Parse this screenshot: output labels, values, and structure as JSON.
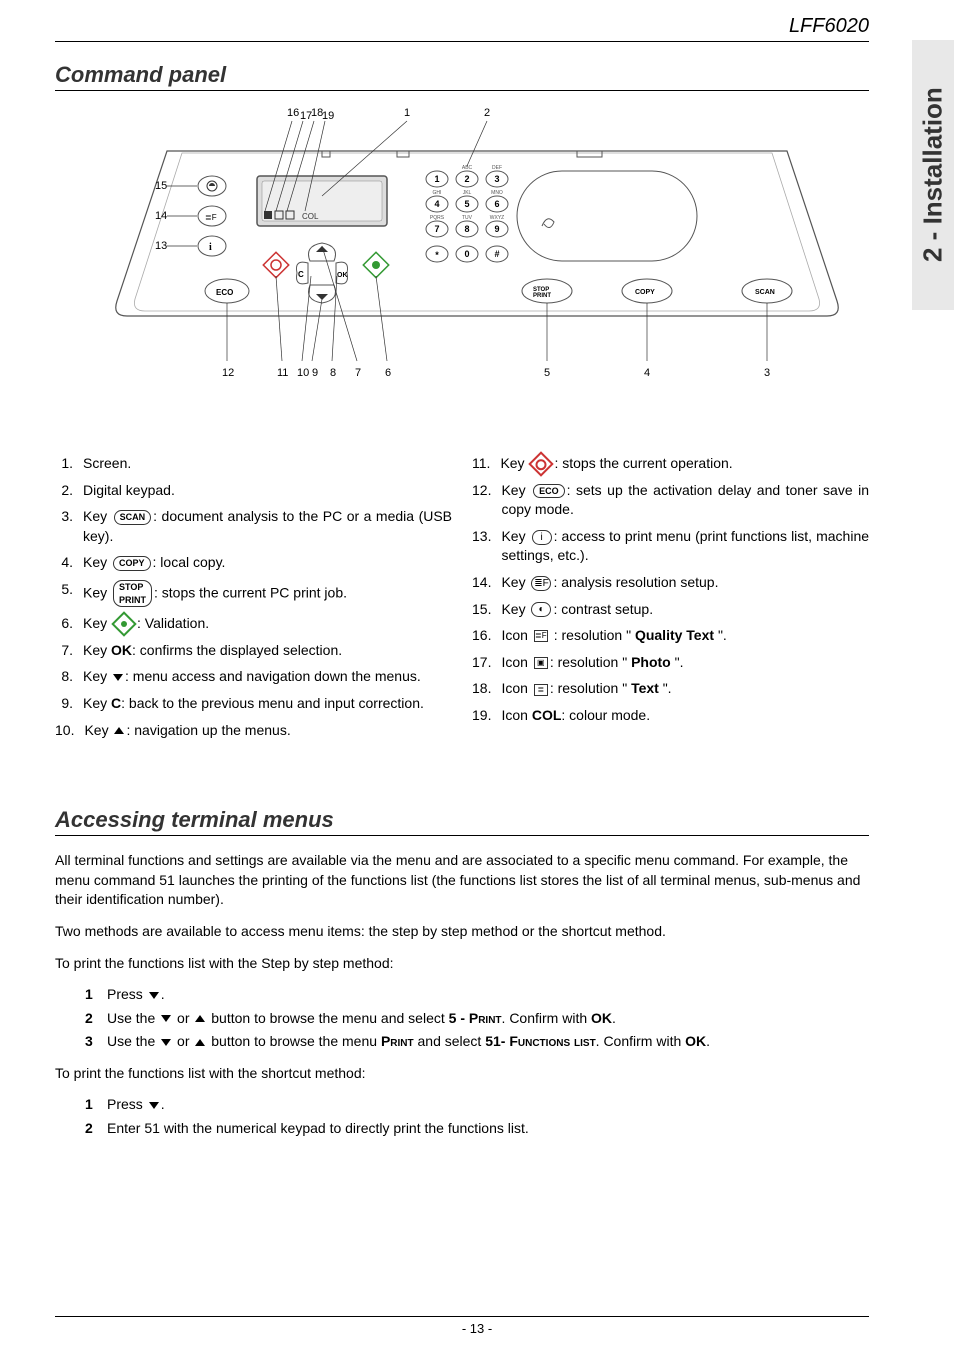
{
  "header": {
    "model": "LFF6020"
  },
  "side_tab": "2 - Installation",
  "section1": {
    "title": "Command panel"
  },
  "diagram": {
    "callouts_top": [
      "16",
      "17",
      "18",
      "19",
      "1",
      "2"
    ],
    "callouts_left": [
      "15",
      "14",
      "13"
    ],
    "callouts_bottom": [
      "12",
      "11",
      "10",
      "9",
      "8",
      "7",
      "6",
      "5",
      "4",
      "3"
    ],
    "keypad_labels": [
      "ABC",
      "DEF",
      "GHI",
      "JKL",
      "MNO",
      "PQRS",
      "TUV",
      "WXYZ"
    ],
    "keypad_nums": [
      "1",
      "2",
      "3",
      "4",
      "5",
      "6",
      "7",
      "8",
      "9",
      "*",
      "0",
      "#"
    ],
    "display_text": "COL",
    "eco": "ECO",
    "stop_print": "STOP PRINT",
    "copy": "COPY",
    "scan": "SCAN",
    "ok": "OK",
    "c": "C",
    "i": "i"
  },
  "items_left": [
    {
      "n": "1.",
      "text_parts": [
        "Screen."
      ]
    },
    {
      "n": "2.",
      "text_parts": [
        "Digital keypad."
      ]
    },
    {
      "n": "3.",
      "text_parts": [
        "Key",
        {
          "key_label": "SCAN"
        },
        ": document analysis to the PC or a media (USB key)."
      ],
      "justify": true
    },
    {
      "n": "4.",
      "text_parts": [
        "Key",
        {
          "key_label": "COPY"
        },
        ": local copy."
      ]
    },
    {
      "n": "5.",
      "text_parts": [
        "Key",
        {
          "key_label": "STOP\nPRINT"
        },
        ": stops the current PC print job."
      ]
    },
    {
      "n": "6.",
      "text_parts": [
        "Key",
        {
          "diamond": true
        },
        ": Validation."
      ]
    },
    {
      "n": "7.",
      "text_parts": [
        "Key ",
        {
          "bold": "OK"
        },
        ": confirms the displayed selection."
      ]
    },
    {
      "n": "8.",
      "text_parts": [
        "Key",
        {
          "tri_down": true
        },
        ": menu access and navigation down the menus."
      ]
    },
    {
      "n": "9.",
      "text_parts": [
        "Key ",
        {
          "bold": "C"
        },
        ": back to the previous menu and input correction."
      ]
    },
    {
      "n": "10.",
      "text_parts": [
        "Key",
        {
          "tri_up": true
        },
        ": navigation up the menus."
      ]
    }
  ],
  "items_right": [
    {
      "n": "11.",
      "text_parts": [
        "Key",
        {
          "stop_icon": true
        },
        ": stops the current operation."
      ]
    },
    {
      "n": "12.",
      "text_parts": [
        "Key",
        {
          "key_label": "ECO"
        },
        ": sets up the activation delay and toner save in copy mode."
      ]
    },
    {
      "n": "13.",
      "text_parts": [
        "Key",
        {
          "oval_label": "i"
        },
        ": access to print menu (print functions list, machine settings, etc.)."
      ],
      "justify": true
    },
    {
      "n": "14.",
      "text_parts": [
        "Key",
        {
          "oval_label": "≣F"
        },
        ": analysis resolution setup."
      ]
    },
    {
      "n": "15.",
      "text_parts": [
        "Key",
        {
          "oval_label": "◐"
        },
        ": contrast setup."
      ]
    },
    {
      "n": "16.",
      "text_parts": [
        "Icon",
        {
          "icon_box": "≣F"
        },
        " : resolution \"",
        {
          "bold": "Quality Text"
        },
        "\"."
      ]
    },
    {
      "n": "17.",
      "text_parts": [
        "Icon",
        {
          "icon_box": "▣"
        },
        ": resolution \"",
        {
          "bold": "Photo"
        },
        "\"."
      ]
    },
    {
      "n": "18.",
      "text_parts": [
        "Icon",
        {
          "icon_box": "≣"
        },
        ": resolution \"",
        {
          "bold": "Text"
        },
        "\"."
      ]
    },
    {
      "n": "19.",
      "text_parts": [
        "Icon ",
        {
          "bold": "COL"
        },
        ": colour mode."
      ]
    }
  ],
  "section2": {
    "title": "Accessing terminal menus",
    "para1": "All terminal functions and settings are available via the menu and are associated to a specific menu command. For example, the menu command 51 launches the printing of the functions list (the functions list stores the list of all terminal menus, sub-menus and their identification number).",
    "para2": "Two methods are available to access menu items: the step by step method or the shortcut method.",
    "para3": "To print the functions list with the Step by step method:",
    "steps_a": [
      {
        "n": "1",
        "parts": [
          "Press",
          {
            "tri_down": true
          },
          "."
        ]
      },
      {
        "n": "2",
        "parts": [
          "Use the",
          {
            "tri_down": true
          },
          "or",
          {
            "tri_up": true
          },
          "button to browse the menu and select ",
          {
            "bold": "5 - "
          },
          {
            "sc": "Print"
          },
          ". Confirm with ",
          {
            "bold": "OK"
          },
          "."
        ]
      },
      {
        "n": "3",
        "parts": [
          "Use the",
          {
            "tri_down": true
          },
          "or",
          {
            "tri_up": true
          },
          "button to browse the menu ",
          {
            "sc": "Print"
          },
          " and select ",
          {
            "bold": "51-"
          },
          {
            "sc": "Functions list"
          },
          ". Confirm with ",
          {
            "bold": "OK"
          },
          "."
        ]
      }
    ],
    "para4": "To print the functions list with the shortcut method:",
    "steps_b": [
      {
        "n": "1",
        "parts": [
          "Press",
          {
            "tri_down": true
          },
          "."
        ]
      },
      {
        "n": "2",
        "parts": [
          "Enter 51 with the numerical keypad to directly print the functions list."
        ]
      }
    ]
  },
  "footer": {
    "page": "- 13 -"
  }
}
